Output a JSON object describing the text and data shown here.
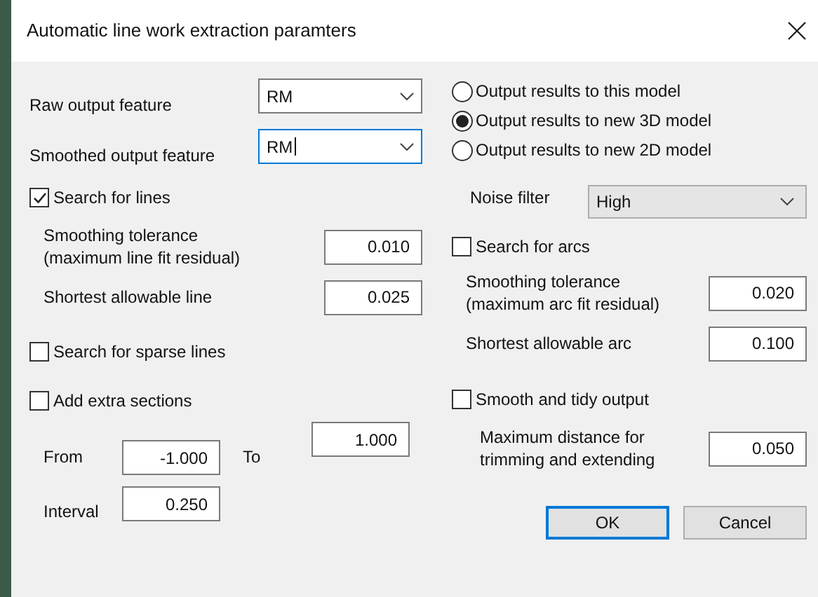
{
  "window": {
    "title": "Automatic line work extraction paramters"
  },
  "features": [
    {
      "label": "Raw output feature",
      "value": "RM",
      "focused": false
    },
    {
      "label": "Smoothed output feature",
      "value": "RM",
      "focused": true
    }
  ],
  "output_options": [
    {
      "label": "Output results to this model",
      "selected": false
    },
    {
      "label": "Output results to new 3D model",
      "selected": true
    },
    {
      "label": "Output results to new 2D model",
      "selected": false
    }
  ],
  "lines": {
    "label": "Search for lines",
    "checked": true,
    "fields": [
      {
        "label": "Smoothing tolerance\n(maximum line fit residual)",
        "value": "0.010"
      },
      {
        "label": "Shortest allowable line",
        "value": "0.025"
      }
    ]
  },
  "sparse_lines": {
    "label": "Search for sparse lines",
    "checked": false
  },
  "extra_sections": {
    "label": "Add extra sections",
    "checked": false,
    "from": {
      "label": "From",
      "value": "-1.000"
    },
    "to": {
      "label": "To",
      "value": "1.000"
    },
    "interval": {
      "label": "Interval",
      "value": "0.250"
    }
  },
  "noise_filter": {
    "label": "Noise filter",
    "value": "High"
  },
  "arcs": {
    "label": "Search for arcs",
    "checked": false,
    "fields": [
      {
        "label": "Smoothing tolerance\n(maximum arc fit residual)",
        "value": "0.020"
      },
      {
        "label": "Shortest allowable arc",
        "value": "0.100"
      }
    ]
  },
  "tidy": {
    "label": "Smooth and tidy output",
    "checked": false,
    "fields": [
      {
        "label": "Maximum distance for\ntrimming and extending",
        "value": "0.050"
      }
    ]
  },
  "buttons": [
    {
      "label": "OK",
      "default": true
    },
    {
      "label": "Cancel",
      "default": false
    }
  ]
}
